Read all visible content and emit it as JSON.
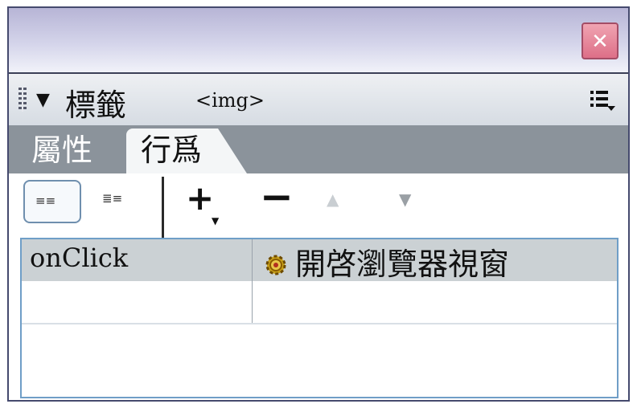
{
  "panel": {
    "title": "標籤",
    "subtitle": "<img>"
  },
  "tabs": {
    "attributes": "屬性",
    "behaviors": "行爲"
  },
  "toolbar": {
    "add": "+",
    "remove": "−",
    "move_up": "▲",
    "move_down": "▼"
  },
  "behaviors": [
    {
      "event": "onClick",
      "action": "開啓瀏覽器視窗"
    },
    {
      "event": "",
      "action": ""
    }
  ],
  "colors": {
    "close_button": "#dd6f88",
    "tab_bar": "#8b939b",
    "selected_row": "#cbd1d4"
  }
}
